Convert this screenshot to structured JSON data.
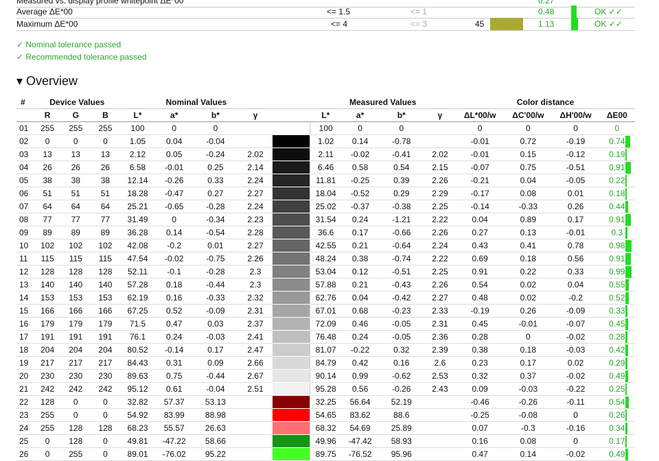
{
  "summary": {
    "rows": [
      {
        "label": "Measured vs. display profile whitepoint ΔE*00",
        "nominal": "",
        "recommended": "",
        "count": "",
        "swatch": "",
        "value": "0.27",
        "status": ""
      },
      {
        "label": "Average ΔE*00",
        "nominal": "<= 1.5",
        "recommended": "<= 1",
        "count": "",
        "swatch": "",
        "value": "0.48",
        "status": "OK ✓✓"
      },
      {
        "label": "Maximum ΔE*00",
        "nominal": "<= 4",
        "recommended": "<= 3",
        "count": "45",
        "swatch": "#aaaa33",
        "value": "1.13",
        "status": "OK ✓✓"
      }
    ],
    "nominal_passed": "✓ Nominal tolerance passed",
    "recommended_passed": "✓ Recommended tolerance passed"
  },
  "overview": {
    "title": "▾ Overview",
    "group_headers": [
      "#",
      "Device Values",
      "Nominal Values",
      "Measured Values",
      "Color distance"
    ],
    "columns": [
      "R",
      "G",
      "B",
      "L*",
      "a*",
      "b*",
      "γ",
      "L*",
      "a*",
      "b*",
      "γ",
      "ΔL*00/w",
      "ΔC'00/w",
      "ΔH'00/w",
      "ΔE00"
    ],
    "rows": [
      {
        "id": "01",
        "r": "255",
        "g": "255",
        "b": "255",
        "nl": "100",
        "na": "0",
        "nb": "0",
        "ng": "",
        "color": "#ffffff",
        "ml": "100",
        "ma": "0",
        "mb": "0",
        "mg": "",
        "dl": "0",
        "dc": "0",
        "dh": "0",
        "de": "0",
        "de_val": 0
      },
      {
        "id": "02",
        "r": "0",
        "g": "0",
        "b": "0",
        "nl": "1.05",
        "na": "0.04",
        "nb": "-0.04",
        "ng": "",
        "color": "#030303",
        "ml": "1.02",
        "ma": "0.14",
        "mb": "-0.78",
        "mg": "",
        "dl": "-0.01",
        "dc": "0.72",
        "dh": "-0.19",
        "de": "0.74",
        "de_val": 0.74
      },
      {
        "id": "03",
        "r": "13",
        "g": "13",
        "b": "13",
        "nl": "2.12",
        "na": "0.05",
        "nb": "-0.24",
        "ng": "2.02",
        "color": "#0d0d0d",
        "ml": "2.11",
        "ma": "-0.02",
        "mb": "-0.41",
        "mg": "2.02",
        "dl": "-0.01",
        "dc": "0.15",
        "dh": "-0.12",
        "de": "0.19",
        "de_val": 0.19
      },
      {
        "id": "04",
        "r": "26",
        "g": "26",
        "b": "26",
        "nl": "6.58",
        "na": "-0.01",
        "nb": "0.25",
        "ng": "2.14",
        "color": "#1a1a1a",
        "ml": "6.46",
        "ma": "0.58",
        "mb": "0.54",
        "mg": "2.15",
        "dl": "-0.07",
        "dc": "0.75",
        "dh": "-0.51",
        "de": "0.91",
        "de_val": 0.91
      },
      {
        "id": "05",
        "r": "38",
        "g": "38",
        "b": "38",
        "nl": "12.14",
        "na": "-0.26",
        "nb": "0.33",
        "ng": "2.24",
        "color": "#262626",
        "ml": "11.81",
        "ma": "-0.25",
        "mb": "0.39",
        "mg": "2.26",
        "dl": "-0.21",
        "dc": "0.04",
        "dh": "-0.05",
        "de": "0.22",
        "de_val": 0.22
      },
      {
        "id": "06",
        "r": "51",
        "g": "51",
        "b": "51",
        "nl": "18.28",
        "na": "-0.47",
        "nb": "0.27",
        "ng": "2.27",
        "color": "#333333",
        "ml": "18.04",
        "ma": "-0.52",
        "mb": "0.29",
        "mg": "2.29",
        "dl": "-0.17",
        "dc": "0.08",
        "dh": "0.01",
        "de": "0.18",
        "de_val": 0.18
      },
      {
        "id": "07",
        "r": "64",
        "g": "64",
        "b": "64",
        "nl": "25.21",
        "na": "-0.65",
        "nb": "-0.28",
        "ng": "2.24",
        "color": "#404040",
        "ml": "25.02",
        "ma": "-0.37",
        "mb": "-0.38",
        "mg": "2.25",
        "dl": "-0.14",
        "dc": "-0.33",
        "dh": "0.26",
        "de": "0.44",
        "de_val": 0.44
      },
      {
        "id": "08",
        "r": "77",
        "g": "77",
        "b": "77",
        "nl": "31.49",
        "na": "0",
        "nb": "-0.34",
        "ng": "2.23",
        "color": "#4d4d4d",
        "ml": "31.54",
        "ma": "0.24",
        "mb": "-1.21",
        "mg": "2.22",
        "dl": "0.04",
        "dc": "0.89",
        "dh": "0.17",
        "de": "0.91",
        "de_val": 0.91
      },
      {
        "id": "09",
        "r": "89",
        "g": "89",
        "b": "89",
        "nl": "36.28",
        "na": "0.14",
        "nb": "-0.54",
        "ng": "2.28",
        "color": "#595959",
        "ml": "36.6",
        "ma": "0.17",
        "mb": "-0.66",
        "mg": "2.26",
        "dl": "0.27",
        "dc": "0.13",
        "dh": "-0.01",
        "de": "0.3",
        "de_val": 0.3
      },
      {
        "id": "10",
        "r": "102",
        "g": "102",
        "b": "102",
        "nl": "42.08",
        "na": "-0.2",
        "nb": "0.01",
        "ng": "2.27",
        "color": "#666666",
        "ml": "42.55",
        "ma": "0.21",
        "mb": "-0.64",
        "mg": "2.24",
        "dl": "0.43",
        "dc": "0.41",
        "dh": "0.78",
        "de": "0.98",
        "de_val": 0.98
      },
      {
        "id": "11",
        "r": "115",
        "g": "115",
        "b": "115",
        "nl": "47.54",
        "na": "-0.02",
        "nb": "-0.75",
        "ng": "2.26",
        "color": "#737373",
        "ml": "48.24",
        "ma": "0.38",
        "mb": "-0.74",
        "mg": "2.22",
        "dl": "0.69",
        "dc": "0.18",
        "dh": "0.56",
        "de": "0.91",
        "de_val": 0.91
      },
      {
        "id": "12",
        "r": "128",
        "g": "128",
        "b": "128",
        "nl": "52.11",
        "na": "-0.1",
        "nb": "-0.28",
        "ng": "2.3",
        "color": "#808080",
        "ml": "53.04",
        "ma": "0.12",
        "mb": "-0.51",
        "mg": "2.25",
        "dl": "0.91",
        "dc": "0.22",
        "dh": "0.33",
        "de": "0.99",
        "de_val": 0.99
      },
      {
        "id": "13",
        "r": "140",
        "g": "140",
        "b": "140",
        "nl": "57.28",
        "na": "0.18",
        "nb": "-0.44",
        "ng": "2.3",
        "color": "#8c8c8c",
        "ml": "57.88",
        "ma": "0.21",
        "mb": "-0.43",
        "mg": "2.26",
        "dl": "0.54",
        "dc": "0.02",
        "dh": "0.04",
        "de": "0.55",
        "de_val": 0.55
      },
      {
        "id": "14",
        "r": "153",
        "g": "153",
        "b": "153",
        "nl": "62.19",
        "na": "0.16",
        "nb": "-0.33",
        "ng": "2.32",
        "color": "#999999",
        "ml": "62.76",
        "ma": "0.04",
        "mb": "-0.42",
        "mg": "2.27",
        "dl": "0.48",
        "dc": "0.02",
        "dh": "-0.2",
        "de": "0.52",
        "de_val": 0.52
      },
      {
        "id": "15",
        "r": "166",
        "g": "166",
        "b": "166",
        "nl": "67.25",
        "na": "0.52",
        "nb": "-0.09",
        "ng": "2.31",
        "color": "#a6a6a6",
        "ml": "67.01",
        "ma": "0.68",
        "mb": "-0.23",
        "mg": "2.33",
        "dl": "-0.19",
        "dc": "0.26",
        "dh": "-0.09",
        "de": "0.33",
        "de_val": 0.33
      },
      {
        "id": "16",
        "r": "179",
        "g": "179",
        "b": "179",
        "nl": "71.5",
        "na": "0.47",
        "nb": "0.03",
        "ng": "2.37",
        "color": "#b3b3b3",
        "ml": "72.09",
        "ma": "0.46",
        "mb": "-0.05",
        "mg": "2.31",
        "dl": "0.45",
        "dc": "-0.01",
        "dh": "-0.07",
        "de": "0.45",
        "de_val": 0.45
      },
      {
        "id": "17",
        "r": "191",
        "g": "191",
        "b": "191",
        "nl": "76.1",
        "na": "0.24",
        "nb": "-0.03",
        "ng": "2.41",
        "color": "#bfbfbf",
        "ml": "76.48",
        "ma": "0.24",
        "mb": "-0.05",
        "mg": "2.36",
        "dl": "0.28",
        "dc": "0",
        "dh": "-0.02",
        "de": "0.28",
        "de_val": 0.28
      },
      {
        "id": "18",
        "r": "204",
        "g": "204",
        "b": "204",
        "nl": "80.52",
        "na": "-0.14",
        "nb": "0.17",
        "ng": "2.47",
        "color": "#cccccc",
        "ml": "81.07",
        "ma": "-0.22",
        "mb": "0.32",
        "mg": "2.39",
        "dl": "0.38",
        "dc": "0.18",
        "dh": "-0.03",
        "de": "0.42",
        "de_val": 0.42
      },
      {
        "id": "19",
        "r": "217",
        "g": "217",
        "b": "217",
        "nl": "84.43",
        "na": "0.31",
        "nb": "0.09",
        "ng": "2.66",
        "color": "#d9d9d9",
        "ml": "84.79",
        "ma": "0.42",
        "mb": "0.16",
        "mg": "2.6",
        "dl": "0.23",
        "dc": "0.17",
        "dh": "0.02",
        "de": "0.29",
        "de_val": 0.29
      },
      {
        "id": "20",
        "r": "230",
        "g": "230",
        "b": "230",
        "nl": "89.63",
        "na": "0.75",
        "nb": "-0.44",
        "ng": "2.67",
        "color": "#e6e6e6",
        "ml": "90.14",
        "ma": "0.99",
        "mb": "-0.62",
        "mg": "2.53",
        "dl": "0.32",
        "dc": "0.37",
        "dh": "-0.02",
        "de": "0.49",
        "de_val": 0.49
      },
      {
        "id": "21",
        "r": "242",
        "g": "242",
        "b": "242",
        "nl": "95.12",
        "na": "0.61",
        "nb": "-0.04",
        "ng": "2.51",
        "color": "#f2f2f2",
        "ml": "95.28",
        "ma": "0.56",
        "mb": "-0.26",
        "mg": "2.43",
        "dl": "0.09",
        "dc": "-0.03",
        "dh": "-0.22",
        "de": "0.25",
        "de_val": 0.25
      },
      {
        "id": "22",
        "r": "128",
        "g": "0",
        "b": "0",
        "nl": "32.82",
        "na": "57.37",
        "nb": "53.13",
        "ng": "",
        "color": "#8b0000",
        "ml": "32.25",
        "ma": "56.64",
        "mb": "52.19",
        "mg": "",
        "dl": "-0.46",
        "dc": "-0.26",
        "dh": "-0.11",
        "de": "0.54",
        "de_val": 0.54
      },
      {
        "id": "23",
        "r": "255",
        "g": "0",
        "b": "0",
        "nl": "54.92",
        "na": "83.99",
        "nb": "88.98",
        "ng": "",
        "color": "#ff0000",
        "ml": "54.65",
        "ma": "83.62",
        "mb": "88.6",
        "mg": "",
        "dl": "-0.25",
        "dc": "-0.08",
        "dh": "0",
        "de": "0.26",
        "de_val": 0.26
      },
      {
        "id": "24",
        "r": "255",
        "g": "128",
        "b": "128",
        "nl": "68.23",
        "na": "55.57",
        "nb": "26.63",
        "ng": "",
        "color": "#ff7070",
        "ml": "68.32",
        "ma": "54.69",
        "mb": "25.89",
        "mg": "",
        "dl": "0.07",
        "dc": "-0.3",
        "dh": "-0.16",
        "de": "0.34",
        "de_val": 0.34
      },
      {
        "id": "25",
        "r": "0",
        "g": "128",
        "b": "0",
        "nl": "49.81",
        "na": "-47.22",
        "nb": "58.66",
        "ng": "",
        "color": "#149414",
        "ml": "49.96",
        "ma": "-47.42",
        "mb": "58.93",
        "mg": "",
        "dl": "0.16",
        "dc": "0.08",
        "dh": "0",
        "de": "0.17",
        "de_val": 0.17
      },
      {
        "id": "26",
        "r": "0",
        "g": "255",
        "b": "0",
        "nl": "89.01",
        "na": "-76.02",
        "nb": "95.22",
        "ng": "",
        "color": "#44ff22",
        "ml": "89.75",
        "ma": "-76.52",
        "mb": "95.96",
        "mg": "",
        "dl": "0.47",
        "dc": "0.14",
        "dh": "-0.02",
        "de": "0.49",
        "de_val": 0.49
      }
    ]
  },
  "colors": {
    "ok_green": "#2ea52e",
    "bar_green": "#22dd22",
    "tolerance_gray": "#aaaaaa"
  }
}
